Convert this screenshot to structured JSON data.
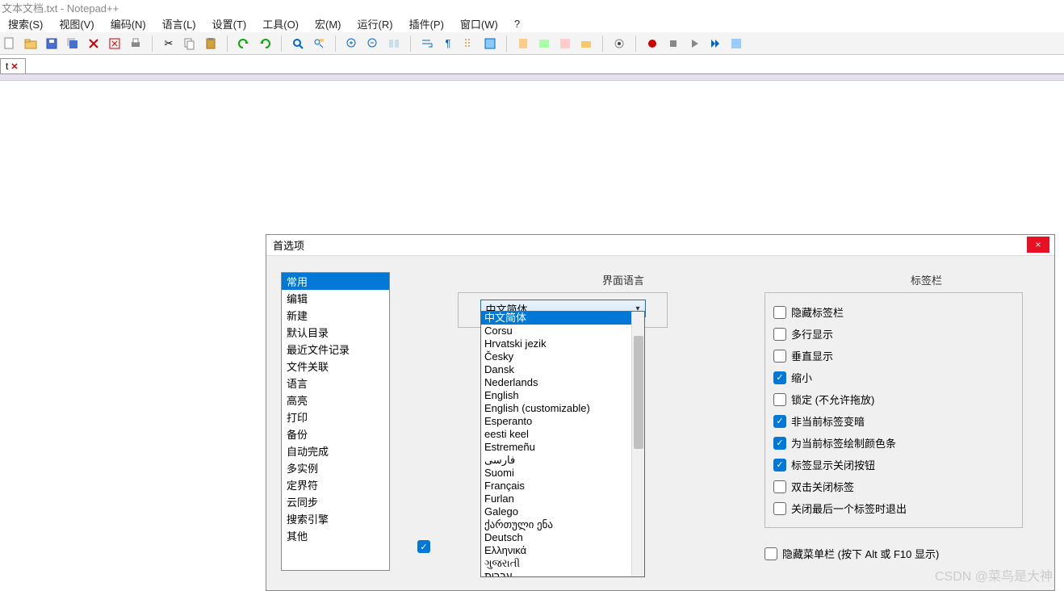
{
  "app": {
    "title": "文本文档.txt - Notepad++"
  },
  "menubar": [
    "搜索(S)",
    "视图(V)",
    "编码(N)",
    "语言(L)",
    "设置(T)",
    "工具(O)",
    "宏(M)",
    "运行(R)",
    "插件(P)",
    "窗口(W)",
    "?"
  ],
  "tab": {
    "name": "t",
    "close": "✕"
  },
  "dialog": {
    "title": "首选项",
    "categories": [
      "常用",
      "编辑",
      "新建",
      "默认目录",
      "最近文件记录",
      "文件关联",
      "语言",
      "高亮",
      "打印",
      "备份",
      "自动完成",
      "多实例",
      "定界符",
      "云同步",
      "搜索引擎",
      "其他"
    ],
    "selected_category": 0
  },
  "midcol_label": "界面语言",
  "combo_selected": "中文简体",
  "lang_options": [
    "中文简体",
    "Corsu",
    "Hrvatski jezik",
    "Česky",
    "Dansk",
    "Nederlands",
    "English",
    "English (customizable)",
    "Esperanto",
    "eesti keel",
    "Estremeñu",
    "فارسی",
    "Suomi",
    "Français",
    "Furlan",
    "Galego",
    "ქართული ენა",
    "Deutsch",
    "Ελληνικά",
    "ગુજરાતી",
    "עברית"
  ],
  "lang_selected_index": 0,
  "rightcol_label": "标签栏",
  "tabbar_opts": [
    {
      "label": "隐藏标签栏",
      "checked": false
    },
    {
      "label": "多行显示",
      "checked": false
    },
    {
      "label": "垂直显示",
      "checked": false
    },
    {
      "label": "缩小",
      "checked": true
    },
    {
      "label": "锁定 (不允许拖放)",
      "checked": false
    },
    {
      "label": "非当前标签变暗",
      "checked": true
    },
    {
      "label": "为当前标签绘制颜色条",
      "checked": true
    },
    {
      "label": "标签显示关闭按钮",
      "checked": true
    },
    {
      "label": "双击关闭标签",
      "checked": false
    },
    {
      "label": "关闭最后一个标签时退出",
      "checked": false
    }
  ],
  "bottom_chk": {
    "label": "隐藏菜单栏 (按下 Alt 或 F10 显示)",
    "checked": false
  },
  "hidden_radio_checked": true,
  "watermark": "CSDN @菜鸟是大神"
}
